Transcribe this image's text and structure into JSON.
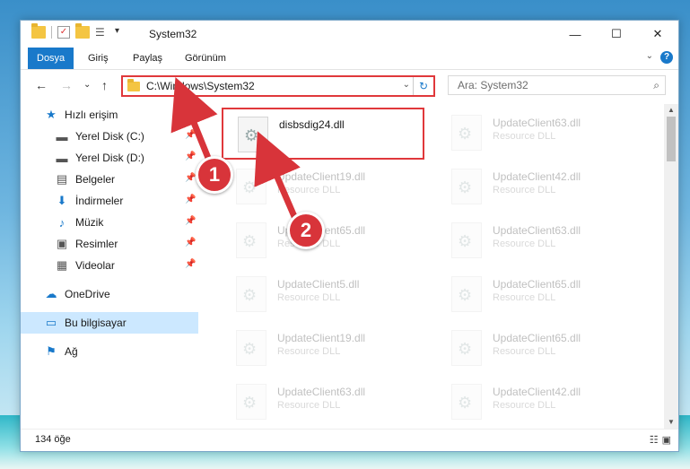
{
  "window": {
    "title": "System32",
    "min": "—",
    "max": "☐",
    "close": "✕"
  },
  "ribbon": {
    "tabs": [
      "Dosya",
      "Giriş",
      "Paylaş",
      "Görünüm"
    ],
    "help": "?",
    "collapse": "⌄"
  },
  "nav": {
    "back": "←",
    "forward": "→",
    "recent": "⌄",
    "up": "↑",
    "address": "C:\\Windows\\System32",
    "dropdown": "⌄",
    "refresh": "↻"
  },
  "search": {
    "placeholder": "Ara: System32",
    "icon": "search-icon"
  },
  "sidebar": {
    "items": [
      {
        "label": "Hızlı erişim",
        "icon": "star-icon",
        "glyph": "★",
        "pinned": false
      },
      {
        "label": "Yerel Disk (C:)",
        "icon": "drive-icon",
        "glyph": "▬",
        "pinned": true
      },
      {
        "label": "Yerel Disk (D:)",
        "icon": "drive-icon",
        "glyph": "▬",
        "pinned": true
      },
      {
        "label": "Belgeler",
        "icon": "documents-icon",
        "glyph": "▤",
        "pinned": true
      },
      {
        "label": "İndirmeler",
        "icon": "download-icon",
        "glyph": "⬇",
        "pinned": true
      },
      {
        "label": "Müzik",
        "icon": "music-icon",
        "glyph": "♪",
        "pinned": true
      },
      {
        "label": "Resimler",
        "icon": "pictures-icon",
        "glyph": "▣",
        "pinned": true
      },
      {
        "label": "Videolar",
        "icon": "video-icon",
        "glyph": "▦",
        "pinned": true
      },
      {
        "label": "OneDrive",
        "icon": "cloud-icon",
        "glyph": "☁",
        "pinned": false
      },
      {
        "label": "Bu bilgisayar",
        "icon": "computer-icon",
        "glyph": "▭",
        "pinned": false
      },
      {
        "label": "Ağ",
        "icon": "network-icon",
        "glyph": "⚑",
        "pinned": false
      }
    ]
  },
  "files": [
    {
      "name": "disbsdig24.dll",
      "type": ""
    },
    {
      "name": "UpdateClient63.dll",
      "type": "Resource DLL"
    },
    {
      "name": "UpdateClient19.dll",
      "type": "Resource DLL"
    },
    {
      "name": "UpdateClient42.dll",
      "type": "Resource DLL"
    },
    {
      "name": "UpdateClient65.dll",
      "type": "Resource DLL"
    },
    {
      "name": "UpdateClient63.dll",
      "type": "Resource DLL"
    },
    {
      "name": "UpdateClient5.dll",
      "type": "Resource DLL"
    },
    {
      "name": "UpdateClient65.dll",
      "type": "Resource DLL"
    },
    {
      "name": "UpdateClient19.dll",
      "type": "Resource DLL"
    },
    {
      "name": "UpdateClient65.dll",
      "type": "Resource DLL"
    },
    {
      "name": "UpdateClient63.dll",
      "type": "Resource DLL"
    },
    {
      "name": "UpdateClient42.dll",
      "type": "Resource DLL"
    }
  ],
  "status": {
    "count": "134 öğe"
  },
  "annotations": {
    "badge1": "1",
    "badge2": "2",
    "highlight_color": "#e0383b"
  }
}
